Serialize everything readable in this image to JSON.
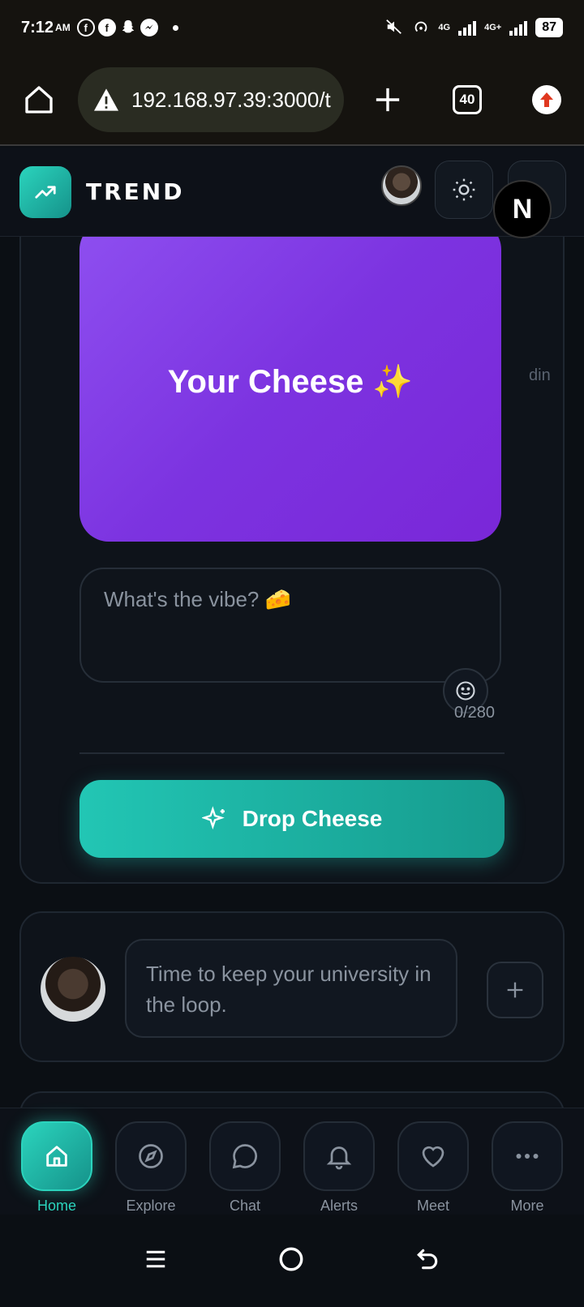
{
  "status_bar": {
    "time": "7:12",
    "ampm": "AM",
    "network_1": "4G",
    "network_2": "4G+",
    "battery": "87",
    "apps": [
      "facebook-messenger-icon",
      "facebook-icon",
      "snapchat-icon",
      "messenger-icon"
    ]
  },
  "browser": {
    "url": "192.168.97.39:3000/t",
    "tab_count": "40"
  },
  "header": {
    "brand": "TREND",
    "badge_letter": "N"
  },
  "composer": {
    "preview_text": "Your Cheese ✨",
    "side_text": "din",
    "placeholder": "What's the vibe? 🧀",
    "counter": "0/280",
    "drop_label": "Drop Cheese"
  },
  "share": {
    "placeholder": "Time to keep your university in the loop."
  },
  "nav": {
    "items": [
      {
        "label": "Home",
        "icon": "home-icon",
        "active": true
      },
      {
        "label": "Explore",
        "icon": "compass-icon",
        "active": false
      },
      {
        "label": "Chat",
        "icon": "chat-bubble-icon",
        "active": false
      },
      {
        "label": "Alerts",
        "icon": "bell-icon",
        "active": false
      },
      {
        "label": "Meet",
        "icon": "heart-icon",
        "active": false
      },
      {
        "label": "More",
        "icon": "more-dots-icon",
        "active": false
      }
    ]
  },
  "colors": {
    "accent": "#2bd4bd",
    "preview_purple": "#8e4ff0",
    "background": "#0b0f14"
  }
}
